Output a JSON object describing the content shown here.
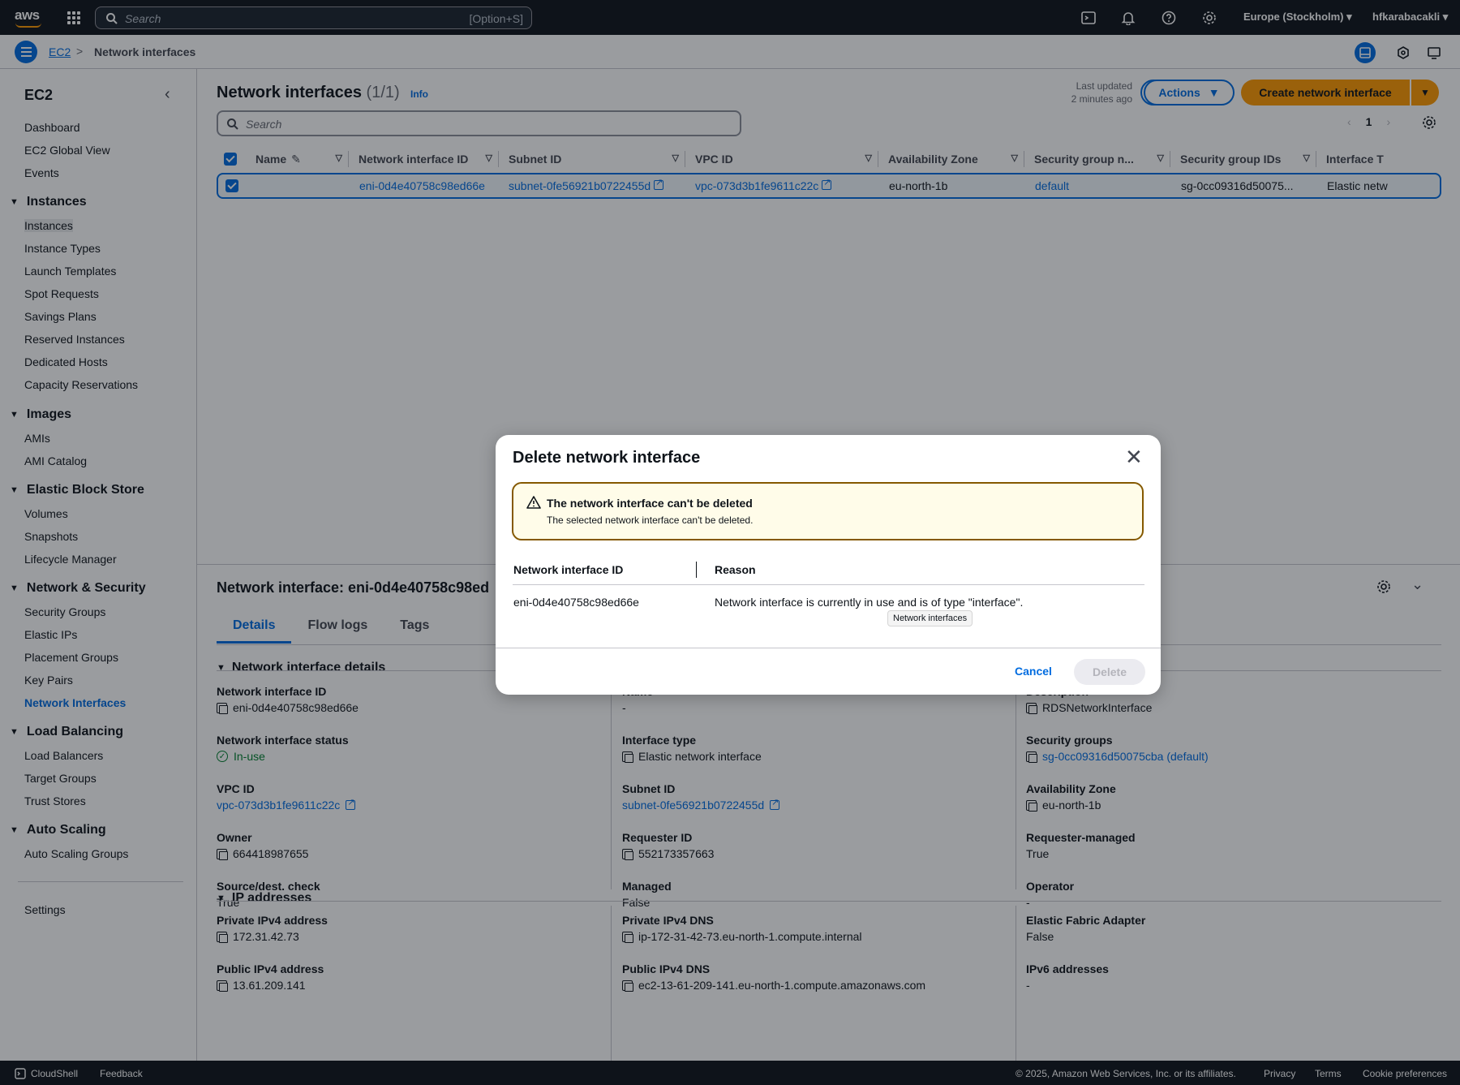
{
  "topnav": {
    "logo_text": "aws",
    "search_placeholder": "Search",
    "search_shortcut": "[Option+S]",
    "region": "Europe (Stockholm)",
    "user": "hfkarabacakli"
  },
  "breadcrumb": {
    "root": "EC2",
    "separator": ">",
    "current": "Network interfaces"
  },
  "sidebar": {
    "title": "EC2",
    "top_items": [
      "Dashboard",
      "EC2 Global View",
      "Events"
    ],
    "sections": [
      {
        "label": "Instances",
        "items": [
          "Instances",
          "Instance Types",
          "Launch Templates",
          "Spot Requests",
          "Savings Plans",
          "Reserved Instances",
          "Dedicated Hosts",
          "Capacity Reservations"
        ]
      },
      {
        "label": "Images",
        "items": [
          "AMIs",
          "AMI Catalog"
        ]
      },
      {
        "label": "Elastic Block Store",
        "items": [
          "Volumes",
          "Snapshots",
          "Lifecycle Manager"
        ]
      },
      {
        "label": "Network & Security",
        "items": [
          "Security Groups",
          "Elastic IPs",
          "Placement Groups",
          "Key Pairs",
          "Network Interfaces"
        ]
      },
      {
        "label": "Load Balancing",
        "items": [
          "Load Balancers",
          "Target Groups",
          "Trust Stores"
        ]
      },
      {
        "label": "Auto Scaling",
        "items": [
          "Auto Scaling Groups"
        ]
      }
    ],
    "settings": "Settings",
    "active_item": "Network Interfaces"
  },
  "header": {
    "title": "Network interfaces",
    "count": "(1/1)",
    "info": "Info",
    "last_updated_label": "Last updated",
    "last_updated_value": "2 minutes ago",
    "actions_label": "Actions",
    "create_label": "Create network interface",
    "search_placeholder": "Search",
    "page_number": "1"
  },
  "table": {
    "columns": [
      "Name",
      "Network interface ID",
      "Subnet ID",
      "VPC ID",
      "Availability Zone",
      "Security group n...",
      "Security group IDs",
      "Interface T"
    ],
    "row": {
      "name": "",
      "eni": "eni-0d4e40758c98ed66e",
      "subnet": "subnet-0fe56921b0722455d",
      "vpc": "vpc-073d3b1fe9611c22c",
      "az": "eu-north-1b",
      "sg_name": "default",
      "sg_ids": "sg-0cc09316d50075...",
      "interface_type": "Elastic netw"
    }
  },
  "details": {
    "title": "Network interface: eni-0d4e40758c98ed",
    "tabs": [
      "Details",
      "Flow logs",
      "Tags"
    ],
    "section1": "Network interface details",
    "section2": "IP addresses",
    "fields": {
      "eni_id": {
        "k": "Network interface ID",
        "v": "eni-0d4e40758c98ed66e"
      },
      "name": {
        "k": "Name",
        "v": "-"
      },
      "description": {
        "k": "Description",
        "v": "RDSNetworkInterface"
      },
      "status": {
        "k": "Network interface status",
        "v": "In-use"
      },
      "interface_type": {
        "k": "Interface type",
        "v": "Elastic network interface"
      },
      "security_groups": {
        "k": "Security groups",
        "v": "sg-0cc09316d50075cba (default)"
      },
      "vpc": {
        "k": "VPC ID",
        "v": "vpc-073d3b1fe9611c22c"
      },
      "subnet": {
        "k": "Subnet ID",
        "v": "subnet-0fe56921b0722455d"
      },
      "az": {
        "k": "Availability Zone",
        "v": "eu-north-1b"
      },
      "owner": {
        "k": "Owner",
        "v": "664418987655"
      },
      "requester": {
        "k": "Requester ID",
        "v": "552173357663"
      },
      "requester_managed": {
        "k": "Requester-managed",
        "v": "True"
      },
      "src_dest": {
        "k": "Source/dest. check",
        "v": "True"
      },
      "managed": {
        "k": "Managed",
        "v": "False"
      },
      "operator": {
        "k": "Operator",
        "v": "-"
      },
      "private_ip": {
        "k": "Private IPv4 address",
        "v": "172.31.42.73"
      },
      "private_dns": {
        "k": "Private IPv4 DNS",
        "v": "ip-172-31-42-73.eu-north-1.compute.internal"
      },
      "efa": {
        "k": "Elastic Fabric Adapter",
        "v": "False"
      },
      "public_ip": {
        "k": "Public IPv4 address",
        "v": "13.61.209.141"
      },
      "public_dns": {
        "k": "Public IPv4 DNS",
        "v": "ec2-13-61-209-141.eu-north-1.compute.amazonaws.com"
      },
      "ipv6": {
        "k": "IPv6 addresses",
        "v": "-"
      }
    }
  },
  "modal": {
    "title": "Delete network interface",
    "alert_title": "The network interface can't be deleted",
    "alert_text": "The selected network interface can't be deleted.",
    "col_id": "Network interface ID",
    "col_reason": "Reason",
    "row_id": "eni-0d4e40758c98ed66e",
    "row_reason": "Network interface is currently in use and is of type \"interface\".",
    "tooltip": "Network interfaces",
    "cancel": "Cancel",
    "delete": "Delete"
  },
  "footer": {
    "cloudshell": "CloudShell",
    "feedback": "Feedback",
    "copyright": "© 2025, Amazon Web Services, Inc. or its affiliates.",
    "privacy": "Privacy",
    "terms": "Terms",
    "cookies": "Cookie preferences"
  },
  "colors": {
    "link": "#006ce0",
    "primary": "#ff9900",
    "warning_border": "#855900",
    "warning_bg": "#fffce9",
    "success": "#00802f"
  }
}
